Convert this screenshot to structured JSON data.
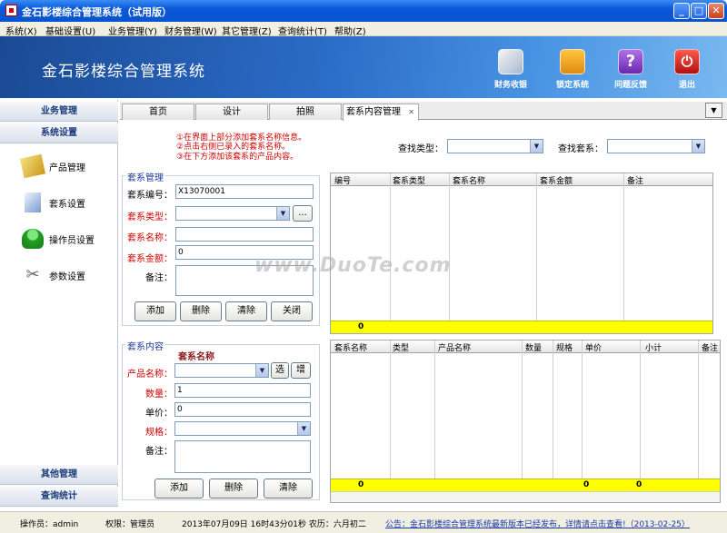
{
  "window": {
    "title": "金石影楼综合管理系统（试用版）",
    "min": "_",
    "max": "□",
    "close": "✕"
  },
  "menu": [
    "系统(X)",
    "基础设置(U)",
    "业务管理(Y)",
    "财务管理(W)",
    "其它管理(Z)",
    "查询统计(T)",
    "帮助(Z)"
  ],
  "banner": {
    "title": "金石影楼综合管理系统",
    "toolbar": [
      {
        "label": "财务收银",
        "icon": "cashier-icon",
        "color": "#d0d8e8"
      },
      {
        "label": "锁定系统",
        "icon": "lock-icon",
        "color": "#f0a020"
      },
      {
        "label": "问题反馈",
        "icon": "question-icon",
        "color": "#8a3cc8"
      },
      {
        "label": "退出",
        "icon": "power-icon",
        "color": "#d82020"
      }
    ]
  },
  "sidebar": {
    "section1": "业务管理",
    "section2": "系统设置",
    "items": [
      {
        "label": "产品管理",
        "icon": "product-icon"
      },
      {
        "label": "套系设置",
        "icon": "package-icon"
      },
      {
        "label": "操作员设置",
        "icon": "user-icon"
      },
      {
        "label": "参数设置",
        "icon": "tools-icon"
      }
    ],
    "section3": "其他管理",
    "section4": "查询统计"
  },
  "tabs": [
    "首页",
    "设计",
    "拍照",
    "套系内容管理"
  ],
  "tab_close": "✕",
  "tab_dropdown": "▼",
  "hints": [
    "①在界面上部分添加套系名称信息。",
    "②点击右侧已录入的套系名称。",
    "③在下方添加该套系的产品内容。"
  ],
  "search": {
    "type_label": "查找类型：",
    "package_label": "查找套系："
  },
  "package_mgmt": {
    "title": "套系管理",
    "fields": {
      "code_label": "套系编号：",
      "code_value": "X13070001",
      "type_label": "套系类型：",
      "type_more": "...",
      "name_label": "套系名称：",
      "amount_label": "套系金额：",
      "amount_value": "0",
      "note_label": "备注："
    },
    "buttons": [
      "添加",
      "删除",
      "清除",
      "关闭"
    ]
  },
  "top_grid": {
    "columns": [
      "编号",
      "套系类型",
      "套系名称",
      "套系金额",
      "备注"
    ],
    "sum": "0"
  },
  "package_content": {
    "title": "套系内容",
    "name_header": "套系名称",
    "fields": {
      "product_label": "产品名称：",
      "select_btn": "选",
      "add_btn": "增",
      "qty_label": "数量：",
      "qty_value": "1",
      "price_label": "单价：",
      "price_value": "0",
      "spec_label": "规格：",
      "note_label": "备注："
    },
    "buttons": [
      "添加",
      "删除",
      "清除"
    ]
  },
  "bottom_grid": {
    "columns": [
      "套系名称",
      "类型",
      "产品名称",
      "数量",
      "规格",
      "单价",
      "小计",
      "备注"
    ],
    "sum_first": "0",
    "sum_price": "0",
    "sum_total": "0"
  },
  "status": {
    "operator": "操作员：admin",
    "permission": "权限：管理员",
    "datetime": "2013年07月09日 16时43分01秒 农历：六月初二",
    "notice": "公告：金石影楼综合管理系统最新版本已经发布，详情请点击查看!（2013-02-25）"
  },
  "watermark": "www.DuoTe.com",
  "colors": {
    "titlebar": "#0a58d8",
    "banner": "#2b6cc8",
    "sum_row": "#ffff00",
    "hint": "#cc0000",
    "required": "#cc0000"
  }
}
